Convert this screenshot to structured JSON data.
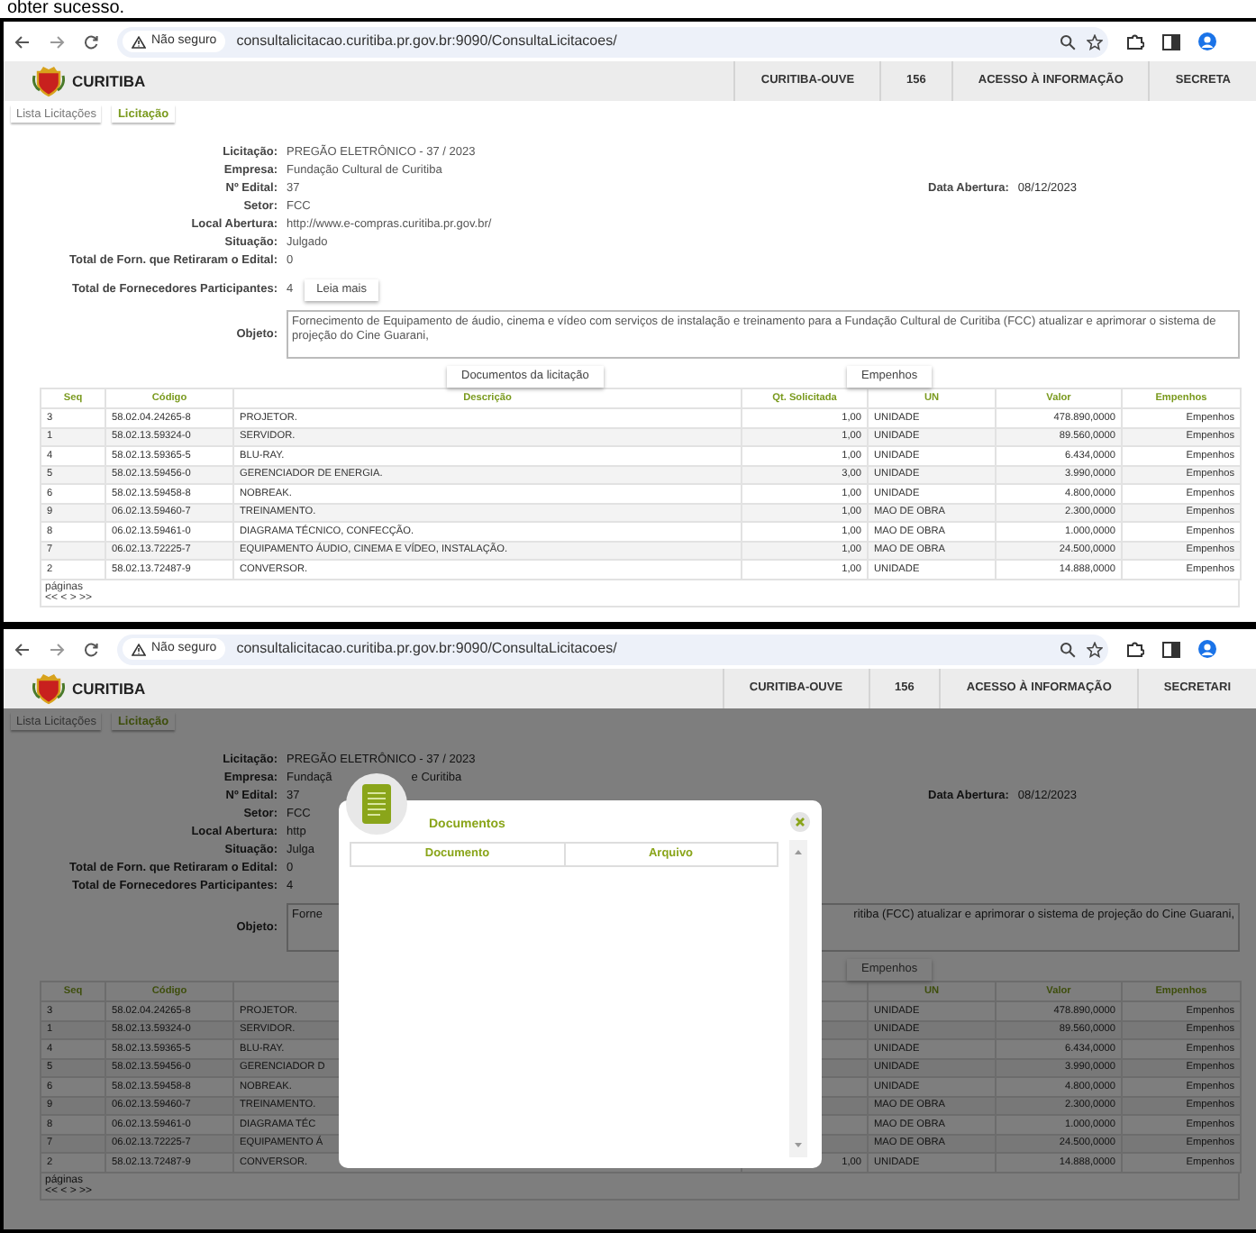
{
  "caption": "obter sucesso.",
  "screens": [
    {
      "browser": {
        "security": "Não seguro",
        "url": "consultalicitacao.curitiba.pr.gov.br:9090/ConsultaLicitacoes/"
      },
      "header": {
        "brand": "CURITIBA",
        "menu": [
          "CURITIBA-OUVE",
          "156",
          "ACESSO À INFORMAÇÃO",
          "SECRETA"
        ]
      },
      "tabs": [
        {
          "label": "Lista Licitações",
          "selected": false
        },
        {
          "label": "Licitação",
          "selected": true
        }
      ],
      "fields": [
        {
          "label": "Licitação:",
          "value": "PREGÃO ELETRÔNICO - 37 / 2023"
        },
        {
          "label": "Empresa:",
          "value": "Fundação Cultural de Curitiba"
        },
        {
          "label": "Nº Edital:",
          "value": "37",
          "aside_label": "Data Abertura:",
          "aside_value": "08/12/2023"
        },
        {
          "label": "Setor:",
          "value": "FCC"
        },
        {
          "label": "Local Abertura:",
          "value": "http://www.e-compras.curitiba.pr.gov.br/"
        },
        {
          "label": "Situação:",
          "value": "Julgado"
        },
        {
          "label": "Total de Forn. que Retiraram o Edital:",
          "value": "0"
        },
        {
          "label": "Total de Fornecedores Participantes:",
          "value": "4",
          "button": "Leia mais"
        }
      ],
      "objeto": {
        "label": "Objeto:",
        "text": [
          "Fornecimento de Equipamento de áudio, cinema e vídeo com serviços de instalação e treinamento para a Fundação Cultural de Curitiba (FCC) atualizar e aprimorar o sistema de projeção do Cine Guarani,"
        ]
      },
      "buttons": [
        {
          "kind": "documents",
          "label": "Documentos da licitação"
        },
        {
          "kind": "empenhos",
          "label": "Empenhos"
        }
      ],
      "table": {
        "columns": [
          "Seq",
          "Código",
          "Descrição",
          "Qt. Solicitada",
          "UN",
          "Valor",
          "Empenhos"
        ],
        "rows": [
          [
            "3",
            "58.02.04.24265-8",
            "PROJETOR.",
            "1,00",
            "UNIDADE",
            "478.890,0000",
            "Empenhos"
          ],
          [
            "1",
            "58.02.13.59324-0",
            "SERVIDOR.",
            "1,00",
            "UNIDADE",
            "89.560,0000",
            "Empenhos"
          ],
          [
            "4",
            "58.02.13.59365-5",
            "BLU-RAY.",
            "1,00",
            "UNIDADE",
            "6.434,0000",
            "Empenhos"
          ],
          [
            "5",
            "58.02.13.59456-0",
            "GERENCIADOR DE ENERGIA.",
            "3,00",
            "UNIDADE",
            "3.990,0000",
            "Empenhos"
          ],
          [
            "6",
            "58.02.13.59458-8",
            "NOBREAK.",
            "1,00",
            "UNIDADE",
            "4.800,0000",
            "Empenhos"
          ],
          [
            "9",
            "06.02.13.59460-7",
            "TREINAMENTO.",
            "1,00",
            "MAO DE OBRA",
            "2.300,0000",
            "Empenhos"
          ],
          [
            "8",
            "06.02.13.59461-0",
            "DIAGRAMA TÉCNICO, CONFECÇÃO.",
            "1,00",
            "MAO DE OBRA",
            "1.000,0000",
            "Empenhos"
          ],
          [
            "7",
            "06.02.13.72225-7",
            "EQUIPAMENTO ÁUDIO, CINEMA E VÍDEO, INSTALAÇÃO.",
            "1,00",
            "MAO DE OBRA",
            "24.500,0000",
            "Empenhos"
          ],
          [
            "2",
            "58.02.13.72487-9",
            "CONVERSOR.",
            "1,00",
            "UNIDADE",
            "14.888,0000",
            "Empenhos"
          ]
        ]
      },
      "pager": {
        "label": "páginas",
        "controls": "<< < > >>"
      }
    },
    {
      "browser": {
        "security": "Não seguro",
        "url": "consultalicitacao.curitiba.pr.gov.br:9090/ConsultaLicitacoes/"
      },
      "header": {
        "brand": "CURITIBA",
        "menu": [
          "CURITIBA-OUVE",
          "156",
          "ACESSO À INFORMAÇÃO",
          "SECRETARI"
        ]
      },
      "tabs": [
        {
          "label": "Lista Licitações",
          "selected": false
        },
        {
          "label": "Licitação",
          "selected": true
        }
      ],
      "fields": [
        {
          "label": "Licitação:",
          "value": "PREGÃO ELETRÔNICO - 37 / 2023"
        },
        {
          "label": "Empresa:",
          "value": "Fundaçã",
          "value_tail": "e Curitiba"
        },
        {
          "label": "Nº Edital:",
          "value": "37",
          "aside_label": "Data Abertura:",
          "aside_value": "08/12/2023"
        },
        {
          "label": "Setor:",
          "value": "FCC"
        },
        {
          "label": "Local Abertura:",
          "value": "http"
        },
        {
          "label": "Situação:",
          "value": "Julga"
        },
        {
          "label": "Total de Forn. que Retiraram o Edital:",
          "value": "0"
        },
        {
          "label": "Total de Fornecedores Participantes:",
          "value": "4"
        }
      ],
      "objeto": {
        "label": "Objeto:",
        "text": [
          "Forne",
          "ritiba (FCC) atualizar e aprimorar o sistema de projeção do Cine Guarani,"
        ]
      },
      "buttons": [
        {
          "kind": "empenhos",
          "label": "Empenhos"
        }
      ],
      "table": {
        "columns": [
          "Seq",
          "Código",
          null,
          null,
          "UN",
          "Valor",
          "Empenhos"
        ],
        "rows": [
          [
            "3",
            "58.02.04.24265-8",
            "PROJETOR.",
            null,
            "UNIDADE",
            "478.890,0000",
            "Empenhos"
          ],
          [
            "1",
            "58.02.13.59324-0",
            "SERVIDOR.",
            null,
            "UNIDADE",
            "89.560,0000",
            "Empenhos"
          ],
          [
            "4",
            "58.02.13.59365-5",
            "BLU-RAY.",
            null,
            "UNIDADE",
            "6.434,0000",
            "Empenhos"
          ],
          [
            "5",
            "58.02.13.59456-0",
            "GERENCIADOR D",
            null,
            "UNIDADE",
            "3.990,0000",
            "Empenhos"
          ],
          [
            "6",
            "58.02.13.59458-8",
            "NOBREAK.",
            null,
            "UNIDADE",
            "4.800,0000",
            "Empenhos"
          ],
          [
            "9",
            "06.02.13.59460-7",
            "TREINAMENTO.",
            null,
            "MAO DE OBRA",
            "2.300,0000",
            "Empenhos"
          ],
          [
            "8",
            "06.02.13.59461-0",
            "DIAGRAMA TÉC",
            null,
            "MAO DE OBRA",
            "1.000,0000",
            "Empenhos"
          ],
          [
            "7",
            "06.02.13.72225-7",
            "EQUIPAMENTO Á",
            null,
            "MAO DE OBRA",
            "24.500,0000",
            "Empenhos"
          ],
          [
            "2",
            "58.02.13.72487-9",
            "CONVERSOR.",
            "1,00",
            "UNIDADE",
            "14.888,0000",
            "Empenhos"
          ]
        ]
      },
      "pager": {
        "label": "páginas",
        "controls": "<< < > >>"
      },
      "dialog": {
        "title": "Documentos",
        "columns": [
          "Documento",
          "Arquivo"
        ]
      }
    }
  ]
}
